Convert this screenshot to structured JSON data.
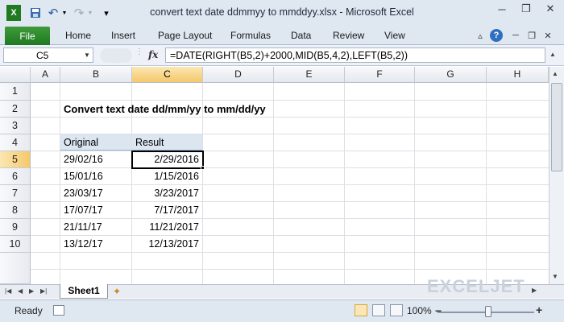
{
  "window": {
    "title": "convert text date ddmmyy to mmddyy.xlsx - Microsoft Excel"
  },
  "ribbon": {
    "file_tab": "File",
    "tabs": [
      "Home",
      "Insert",
      "Page Layout",
      "Formulas",
      "Data",
      "Review",
      "View"
    ]
  },
  "formula_bar": {
    "name_box": "C5",
    "fx_label": "fx",
    "formula": "=DATE(RIGHT(B5,2)+2000,MID(B5,4,2),LEFT(B5,2))"
  },
  "grid": {
    "columns": [
      "A",
      "B",
      "C",
      "D",
      "E",
      "F",
      "G",
      "H"
    ],
    "rows": [
      "1",
      "2",
      "3",
      "4",
      "5",
      "6",
      "7",
      "8",
      "9",
      "10"
    ],
    "selected_column": "C",
    "selected_row": "5",
    "heading": "Convert text date dd/mm/yy to mm/dd/yy",
    "table_headers": {
      "original": "Original",
      "result": "Result"
    },
    "table_rows": [
      {
        "original": "29/02/16",
        "result": "2/29/2016"
      },
      {
        "original": "15/01/16",
        "result": "1/15/2016"
      },
      {
        "original": "23/03/17",
        "result": "3/23/2017"
      },
      {
        "original": "17/07/17",
        "result": "7/17/2017"
      },
      {
        "original": "21/11/17",
        "result": "11/21/2017"
      },
      {
        "original": "13/12/17",
        "result": "12/13/2017"
      }
    ]
  },
  "sheets": {
    "active": "Sheet1"
  },
  "status": {
    "ready": "Ready",
    "zoom": "100%"
  },
  "watermark": "EXCELJET",
  "colors": {
    "file_tab": "#1f7a21",
    "selection_header": "#f5c86a",
    "table_header_fill": "#dce6f1"
  }
}
